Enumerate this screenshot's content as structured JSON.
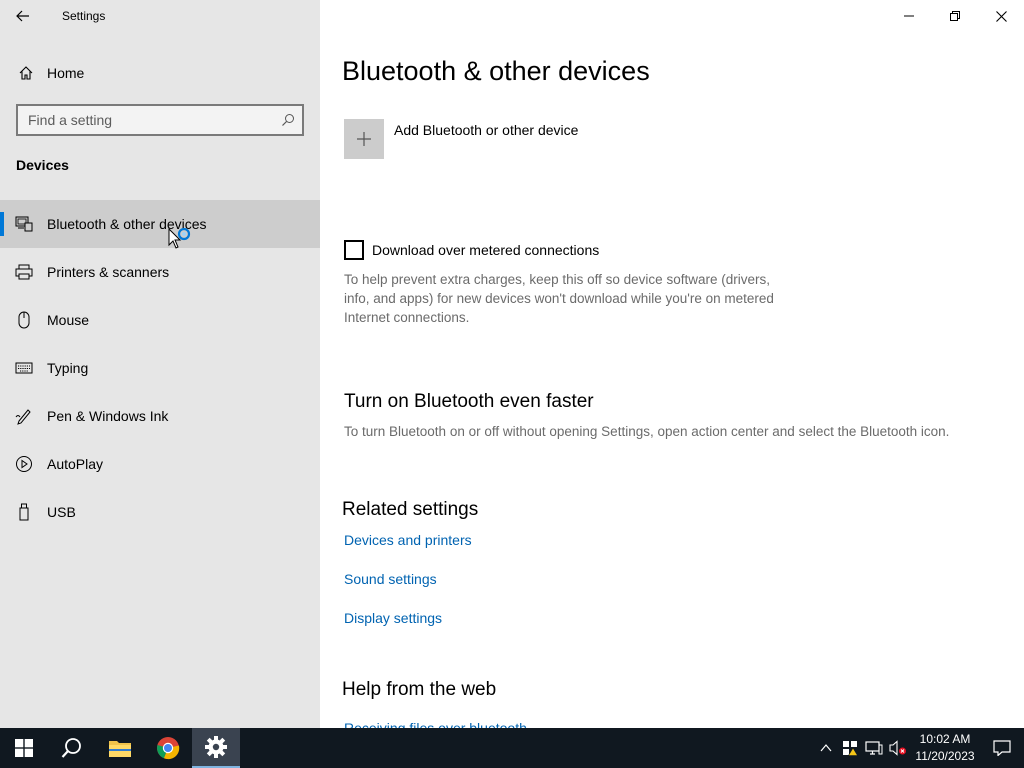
{
  "window": {
    "title": "Settings"
  },
  "sidebar": {
    "home_label": "Home",
    "search_placeholder": "Find a setting",
    "section_label": "Devices",
    "items": [
      {
        "label": "Bluetooth & other devices",
        "icon": "bluetooth-devices-icon",
        "selected": true
      },
      {
        "label": "Printers & scanners",
        "icon": "printer-icon",
        "selected": false
      },
      {
        "label": "Mouse",
        "icon": "mouse-icon",
        "selected": false
      },
      {
        "label": "Typing",
        "icon": "keyboard-icon",
        "selected": false
      },
      {
        "label": "Pen & Windows Ink",
        "icon": "pen-icon",
        "selected": false
      },
      {
        "label": "AutoPlay",
        "icon": "autoplay-icon",
        "selected": false
      },
      {
        "label": "USB",
        "icon": "usb-icon",
        "selected": false
      }
    ]
  },
  "main": {
    "title": "Bluetooth & other devices",
    "add_device_label": "Add Bluetooth or other device",
    "metered": {
      "label": "Download over metered connections",
      "checked": false,
      "help": "To help prevent extra charges, keep this off so device software (drivers, info, and apps) for new devices won't download while you're on metered Internet connections."
    },
    "faster": {
      "heading": "Turn on Bluetooth even faster",
      "description": "To turn Bluetooth on or off without opening Settings, open action center and select the Bluetooth icon."
    },
    "related": {
      "heading": "Related settings",
      "links": [
        "Devices and printers",
        "Sound settings",
        "Display settings"
      ]
    },
    "help_web": {
      "heading": "Help from the web",
      "first_link": "Receiving files over bluetooth"
    }
  },
  "taskbar": {
    "apps": [
      "start",
      "search",
      "file-explorer",
      "chrome",
      "settings"
    ],
    "active_app": "settings",
    "time": "10:02 AM",
    "date": "11/20/2023"
  },
  "colors": {
    "accent": "#0078d7",
    "link": "#0063b1",
    "sidebar_bg": "#e6e6e6",
    "taskbar_bg": "#101820"
  }
}
